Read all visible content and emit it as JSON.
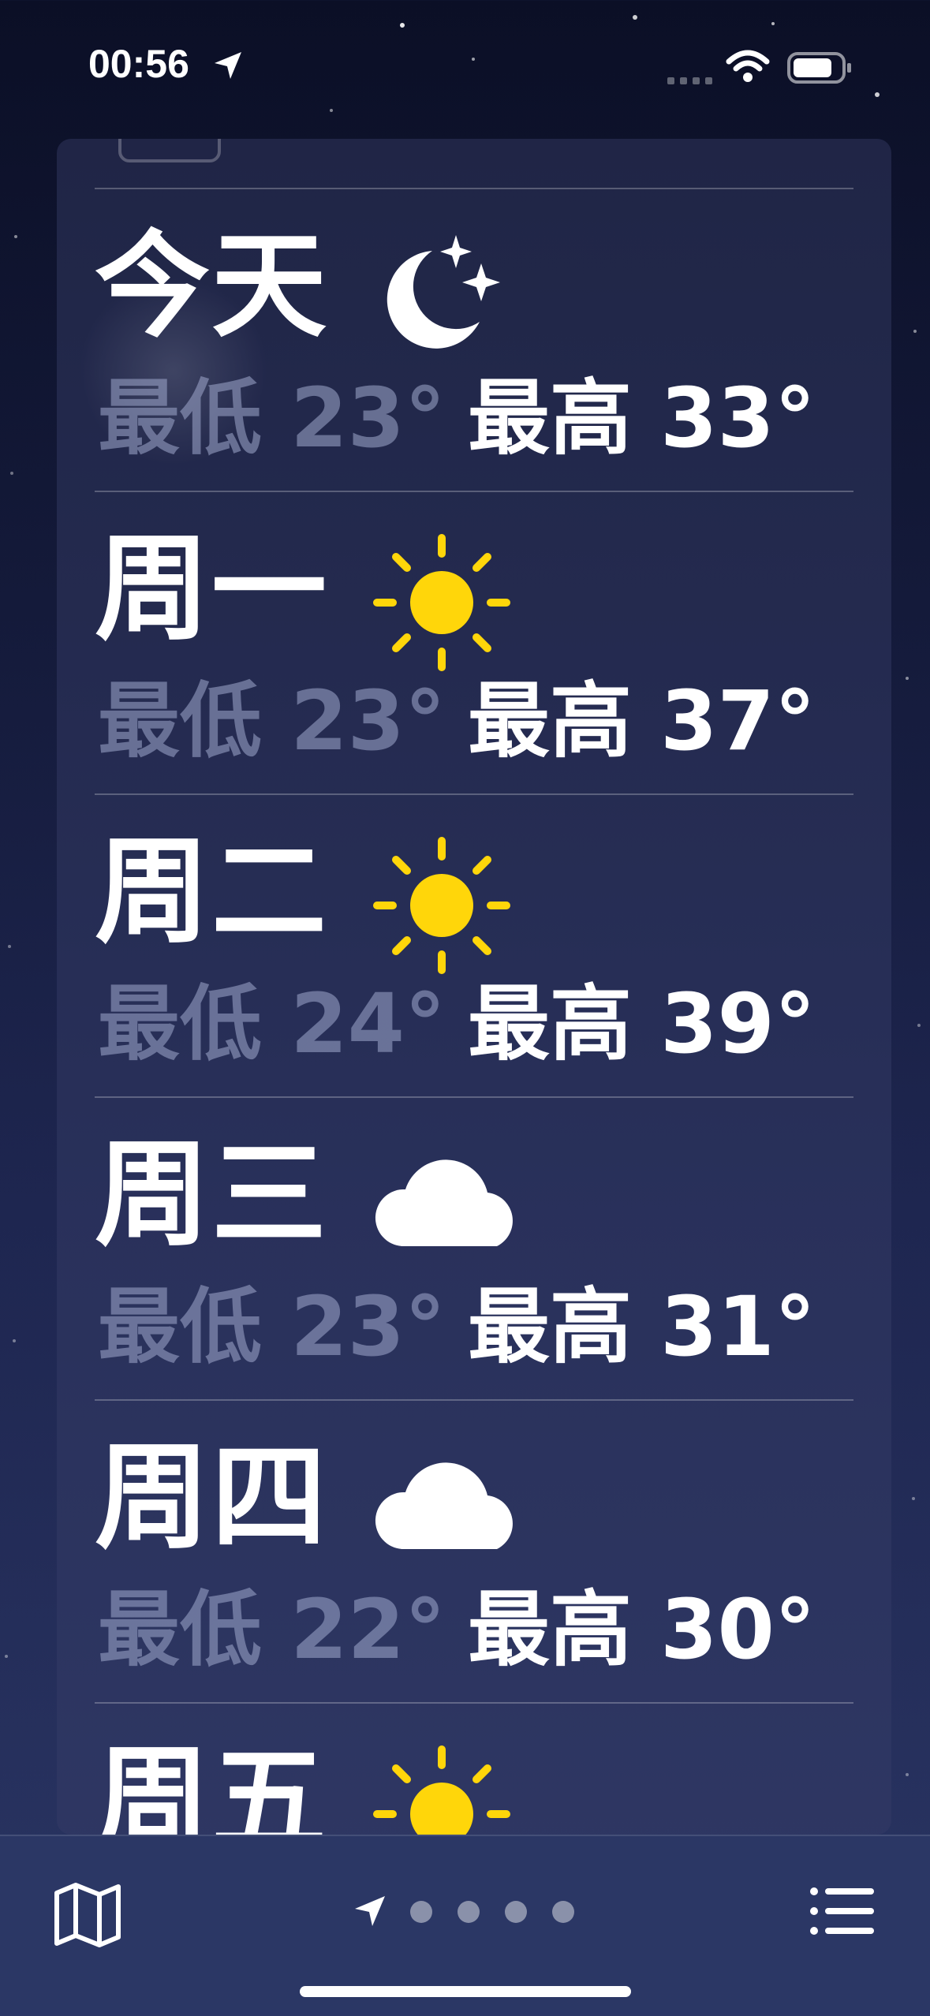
{
  "status_bar": {
    "time": "00:56",
    "icons": [
      "location-arrow-icon",
      "signal-icon",
      "wifi-icon",
      "battery-icon"
    ]
  },
  "forecast": [
    {
      "day": "今天",
      "icon": "moon-stars-icon",
      "low": "最低 23°",
      "high": "最高 33°"
    },
    {
      "day": "周一",
      "icon": "sun-icon",
      "low": "最低 23°",
      "high": "最高 37°"
    },
    {
      "day": "周二",
      "icon": "sun-icon",
      "low": "最低 24°",
      "high": "最高 39°"
    },
    {
      "day": "周三",
      "icon": "cloud-icon",
      "low": "最低 23°",
      "high": "最高 31°"
    },
    {
      "day": "周四",
      "icon": "cloud-icon",
      "low": "最低 22°",
      "high": "最高 30°"
    },
    {
      "day": "周五",
      "icon": "sun-icon",
      "low": "",
      "high": ""
    }
  ],
  "tab_bar": {
    "left_icon": "map-icon",
    "right_icon": "list-icon",
    "pages": 4,
    "current_page": "location"
  },
  "colors": {
    "sun": "#FFD60A",
    "text": "#FFFFFF",
    "low_temp": "#8E96BA",
    "tab_bar_bg": "#2B3765"
  }
}
